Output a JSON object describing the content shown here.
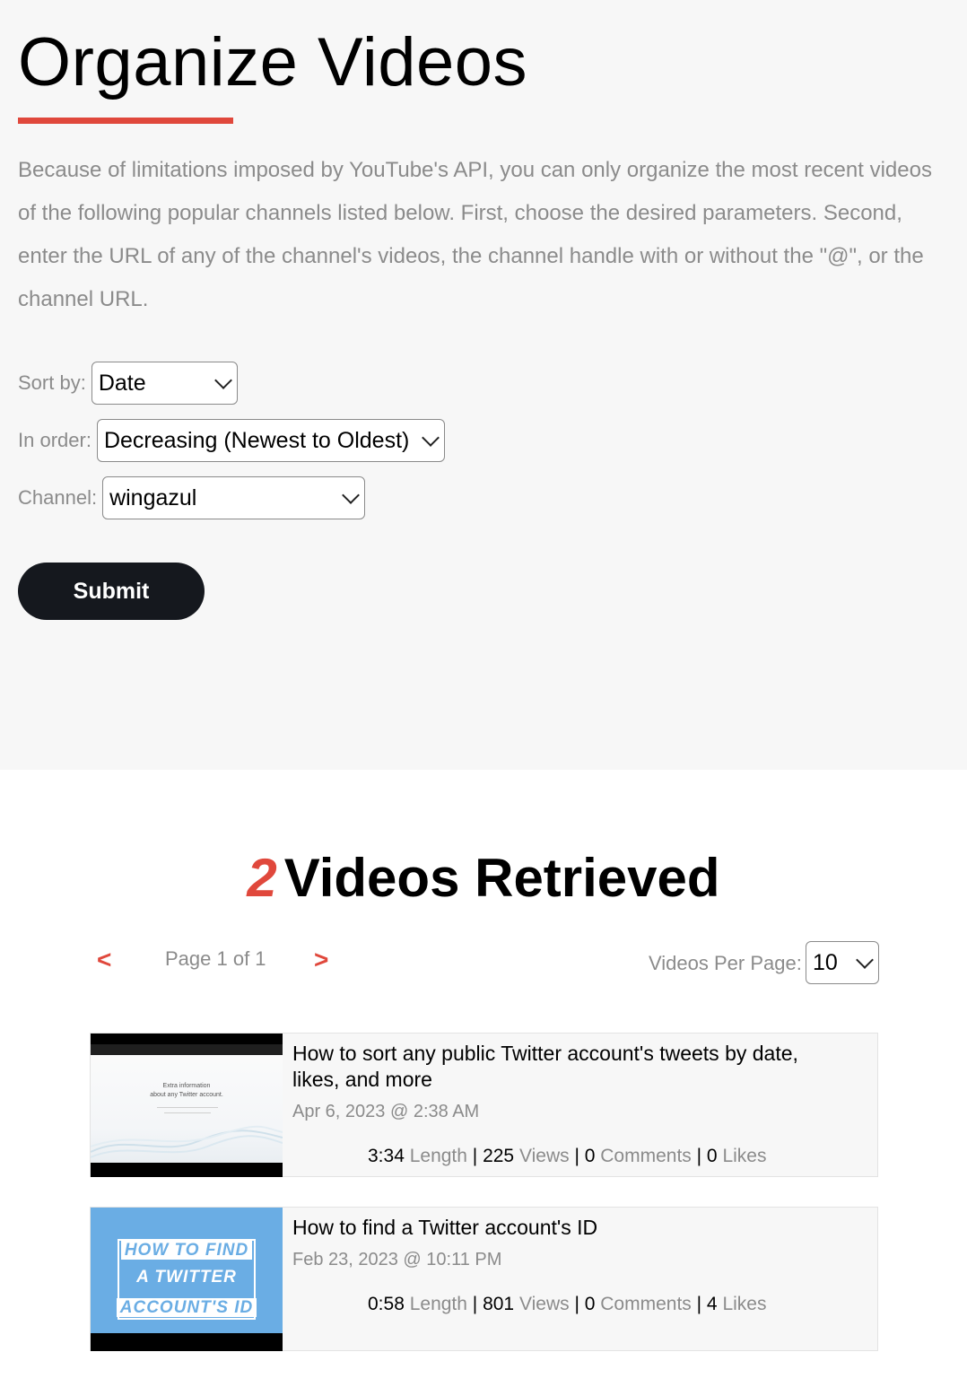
{
  "page": {
    "title": "Organize Videos",
    "description": "Because of limitations imposed by YouTube's API, you can only organize the most recent videos of the following popular channels listed below. First, choose the desired parameters. Second, enter the URL of any of the channel's videos, the channel handle with or without the \"@\", or the channel URL."
  },
  "form": {
    "sort_label": "Sort by:",
    "sort_value": "Date",
    "order_label": "In order:",
    "order_value": "Decreasing (Newest to Oldest)",
    "channel_label": "Channel:",
    "channel_value": "wingazul",
    "submit_label": "Submit"
  },
  "results": {
    "count": "2",
    "heading": "Videos Retrieved",
    "prev": "<",
    "next": ">",
    "page_info": "Page 1 of 1",
    "per_page_label": "Videos Per Page:",
    "per_page_value": "10"
  },
  "videos": [
    {
      "title": "How to sort any public Twitter account's tweets by date, likes, and more",
      "date": "Apr 6, 2023 @ 2:38 AM",
      "length": "3:34",
      "length_label": "Length",
      "views": "225",
      "views_label": "Views",
      "comments": "0",
      "comments_label": "Comments",
      "likes": "0",
      "likes_label": "Likes",
      "thumb_text_1": "Extra information",
      "thumb_text_2": "about any Twitter account."
    },
    {
      "title": "How to find a Twitter account's ID",
      "date": "Feb 23, 2023 @ 10:11 PM",
      "length": "0:58",
      "length_label": "Length",
      "views": "801",
      "views_label": "Views",
      "comments": "0",
      "comments_label": "Comments",
      "likes": "4",
      "likes_label": "Likes",
      "thumb_line_1": "HOW TO FIND",
      "thumb_line_2": "A TWITTER",
      "thumb_line_3": "ACCOUNT'S ID"
    }
  ],
  "colors": {
    "accent": "#e0483c",
    "button": "#15181e",
    "muted_text": "#8b8b8b",
    "thumb_blue": "#6aade4"
  }
}
